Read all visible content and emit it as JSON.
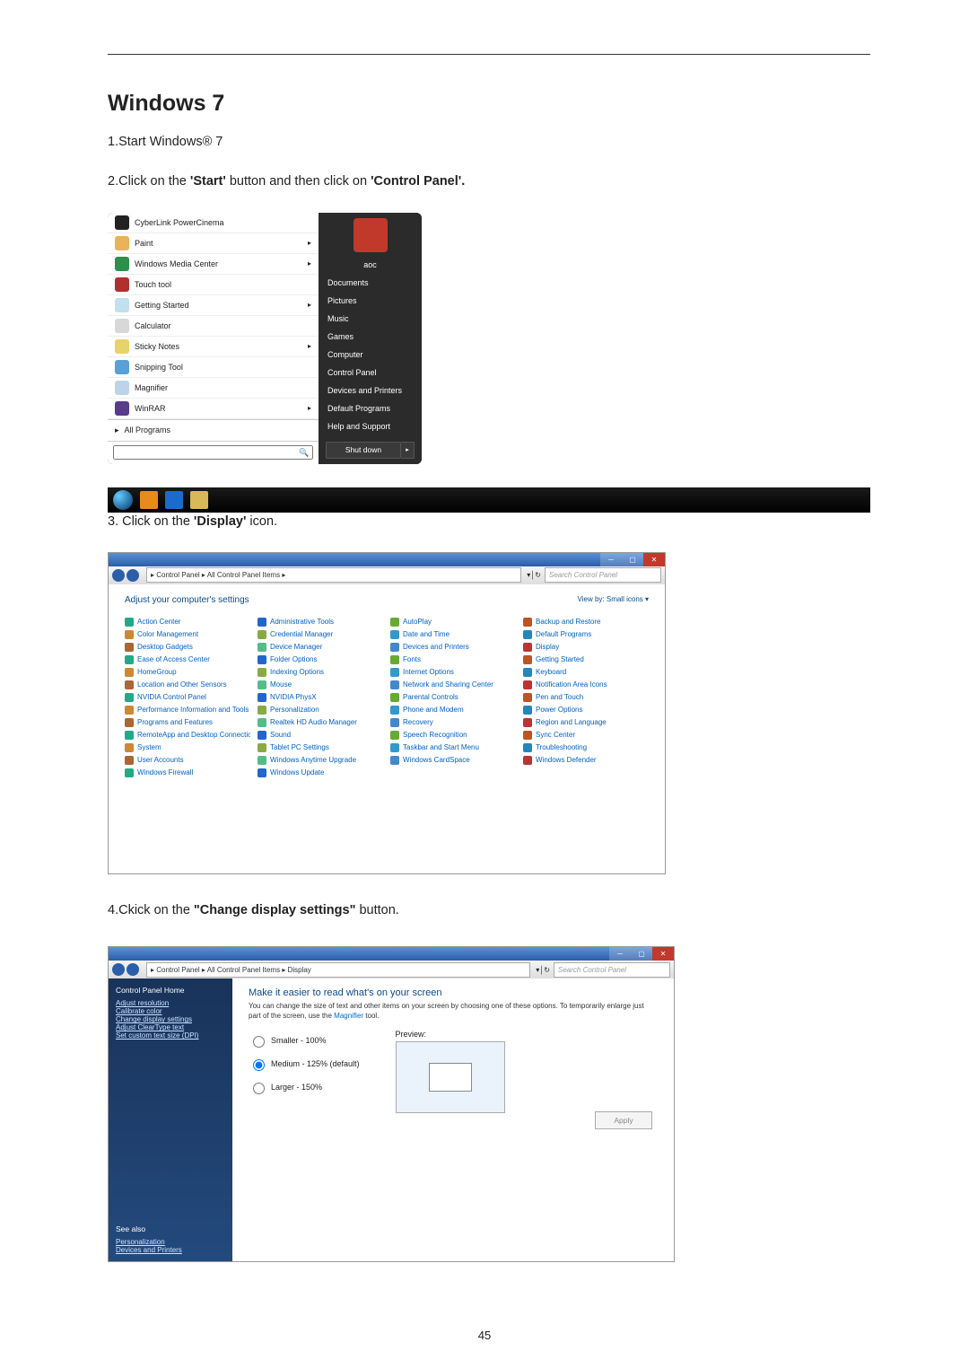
{
  "page_number": "45",
  "heading": "Windows 7",
  "steps": {
    "s1": "1.Start Windows® 7",
    "s2_pre": "2.Click on the ",
    "s2_b1": "'Start'",
    "s2_mid": " button and then click on ",
    "s2_b2": "'Control Panel'.",
    "s3_pre": "3. Click on the ",
    "s3_b": "'Display'",
    "s3_post": " icon.",
    "s4_pre": "4.Ckick on the ",
    "s4_b": "\"Change display settings\"",
    "s4_post": " button."
  },
  "start_menu": {
    "user": "aoc",
    "programs": [
      {
        "label": "CyberLink PowerCinema",
        "color": "#222",
        "arrow": false
      },
      {
        "label": "Paint",
        "color": "#e8b35a",
        "arrow": true
      },
      {
        "label": "Windows Media Center",
        "color": "#2c8f4a",
        "arrow": true
      },
      {
        "label": "Touch tool",
        "color": "#b03030",
        "arrow": false
      },
      {
        "label": "Getting Started",
        "color": "#bfe0ef",
        "arrow": true
      },
      {
        "label": "Calculator",
        "color": "#d8d8d8",
        "arrow": false
      },
      {
        "label": "Sticky Notes",
        "color": "#e8d36a",
        "arrow": true
      },
      {
        "label": "Snipping Tool",
        "color": "#5aa0d8",
        "arrow": false
      },
      {
        "label": "Magnifier",
        "color": "#bcd4e8",
        "arrow": false
      },
      {
        "label": "WinRAR",
        "color": "#5a3a8a",
        "arrow": true
      }
    ],
    "all_programs": "All Programs",
    "right": [
      "Documents",
      "Pictures",
      "Music",
      "Games",
      "Computer",
      "Control Panel",
      "Devices and Printers",
      "Default Programs",
      "Help and Support"
    ],
    "shutdown": "Shut down"
  },
  "control_panel": {
    "breadcrumb": "▸ Control Panel ▸ All Control Panel Items ▸",
    "search_ph": "Search Control Panel",
    "adjust": "Adjust your computer's settings",
    "viewby": "View by:  Small icons ▾",
    "items": [
      "Action Center",
      "Administrative Tools",
      "AutoPlay",
      "Backup and Restore",
      "Color Management",
      "Credential Manager",
      "Date and Time",
      "Default Programs",
      "Desktop Gadgets",
      "Device Manager",
      "Devices and Printers",
      "Display",
      "Ease of Access Center",
      "Folder Options",
      "Fonts",
      "Getting Started",
      "HomeGroup",
      "Indexing Options",
      "Internet Options",
      "Keyboard",
      "Location and Other Sensors",
      "Mouse",
      "Network and Sharing Center",
      "Notification Area Icons",
      "NVIDIA Control Panel",
      "NVIDIA PhysX",
      "Parental Controls",
      "Pen and Touch",
      "Performance Information and Tools",
      "Personalization",
      "Phone and Modem",
      "Power Options",
      "Programs and Features",
      "Realtek HD Audio Manager",
      "Recovery",
      "Region and Language",
      "RemoteApp and Desktop Connections",
      "Sound",
      "Speech Recognition",
      "Sync Center",
      "System",
      "Tablet PC Settings",
      "Taskbar and Start Menu",
      "Troubleshooting",
      "User Accounts",
      "Windows Anytime Upgrade",
      "Windows CardSpace",
      "Windows Defender",
      "Windows Firewall",
      "Windows Update"
    ],
    "icon_colors": [
      "#2a8",
      "#26c",
      "#6a3",
      "#b52",
      "#c83",
      "#8a4",
      "#39c",
      "#28b",
      "#a63",
      "#5b8",
      "#48c",
      "#b33"
    ]
  },
  "display_settings": {
    "breadcrumb": "▸ Control Panel ▸ All Control Panel Items ▸ Display",
    "search_ph": "Search Control Panel",
    "sidebar": {
      "home": "Control Panel Home",
      "links": [
        "Adjust resolution",
        "Calibrate color",
        "Change display settings",
        "Adjust ClearType text",
        "Set custom text size (DPI)"
      ],
      "see_also": "See also",
      "see_links": [
        "Personalization",
        "Devices and Printers"
      ]
    },
    "title": "Make it easier to read what's on your screen",
    "desc_a": "You can change the size of text and other items on your screen by choosing one of these options. To temporarily enlarge just part of the screen, use the ",
    "desc_link": "Magnifier",
    "desc_b": " tool.",
    "radios": [
      "Smaller - 100%",
      "Medium - 125% (default)",
      "Larger - 150%"
    ],
    "preview_label": "Preview:",
    "apply": "Apply"
  }
}
